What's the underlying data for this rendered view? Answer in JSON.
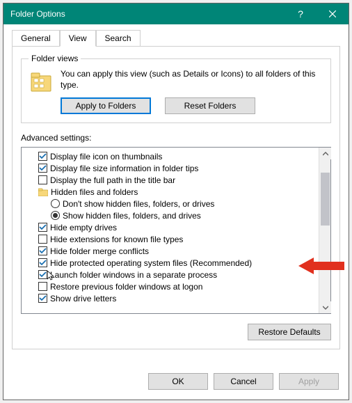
{
  "window": {
    "title": "Folder Options"
  },
  "tabs": {
    "general": "General",
    "view": "View",
    "search": "Search"
  },
  "folder_views": {
    "legend": "Folder views",
    "description": "You can apply this view (such as Details or Icons) to all folders of this type.",
    "apply_btn": "Apply to Folders",
    "reset_btn": "Reset Folders"
  },
  "advanced": {
    "label": "Advanced settings:",
    "items": [
      {
        "type": "check",
        "checked": true,
        "indent": 0,
        "label": "Display file icon on thumbnails"
      },
      {
        "type": "check",
        "checked": true,
        "indent": 0,
        "label": "Display file size information in folder tips"
      },
      {
        "type": "check",
        "checked": false,
        "indent": 0,
        "label": "Display the full path in the title bar"
      },
      {
        "type": "group",
        "indent": 0,
        "label": "Hidden files and folders"
      },
      {
        "type": "radio",
        "checked": false,
        "indent": 1,
        "label": "Don't show hidden files, folders, or drives"
      },
      {
        "type": "radio",
        "checked": true,
        "indent": 1,
        "label": "Show hidden files, folders, and drives"
      },
      {
        "type": "check",
        "checked": true,
        "indent": 0,
        "label": "Hide empty drives"
      },
      {
        "type": "check",
        "checked": false,
        "indent": 0,
        "label": "Hide extensions for known file types"
      },
      {
        "type": "check",
        "checked": true,
        "indent": 0,
        "label": "Hide folder merge conflicts"
      },
      {
        "type": "check",
        "checked": true,
        "indent": 0,
        "label": "Hide protected operating system files (Recommended)"
      },
      {
        "type": "check",
        "checked": true,
        "indent": 0,
        "label": "Launch folder windows in a separate process",
        "cursor": true
      },
      {
        "type": "check",
        "checked": false,
        "indent": 0,
        "label": "Restore previous folder windows at logon"
      },
      {
        "type": "check",
        "checked": true,
        "indent": 0,
        "label": "Show drive letters"
      }
    ]
  },
  "buttons": {
    "restore_defaults": "Restore Defaults",
    "ok": "OK",
    "cancel": "Cancel",
    "apply": "Apply"
  }
}
